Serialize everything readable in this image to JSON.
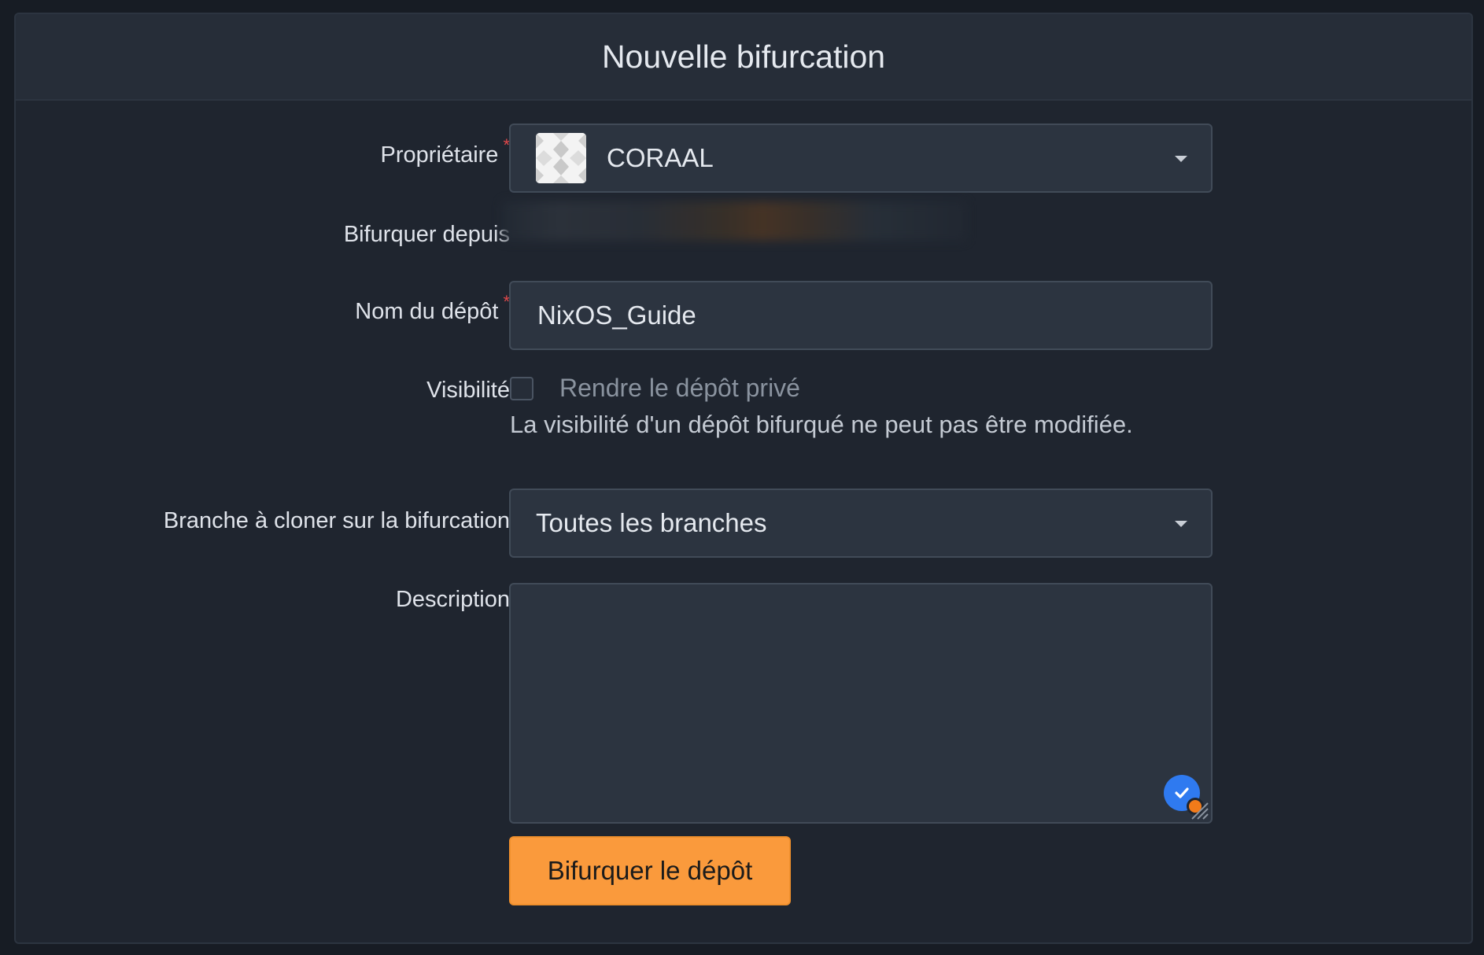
{
  "header": {
    "title": "Nouvelle bifurcation"
  },
  "form": {
    "owner": {
      "label": "Propriétaire",
      "required_mark": "*",
      "selected": "CORAAL"
    },
    "fork_from": {
      "label": "Bifurquer depuis"
    },
    "repo_name": {
      "label": "Nom du dépôt",
      "required_mark": "*",
      "value": "NixOS_Guide"
    },
    "visibility": {
      "label": "Visibilité",
      "checkbox_label": "Rendre le dépôt privé",
      "checked": false,
      "help_text": "La visibilité d'un dépôt bifurqué ne peut pas être modifiée."
    },
    "branch": {
      "label": "Branche à cloner sur la bifurcation",
      "selected": "Toutes les branches"
    },
    "description": {
      "label": "Description",
      "value": ""
    },
    "submit_label": "Bifurquer le dépôt"
  },
  "colors": {
    "page_bg": "#171c24",
    "panel_bg": "#1f252f",
    "field_bg": "#2c3440",
    "accent": "#fa9a3c",
    "required": "#e0484a",
    "grammar_badge": "#2f7af0"
  },
  "icons": {
    "owner_avatar": "identicon-avatar",
    "dropdown": "caret-down-icon",
    "grammar": "grammar-check-icon",
    "resize": "resize-handle-icon"
  }
}
